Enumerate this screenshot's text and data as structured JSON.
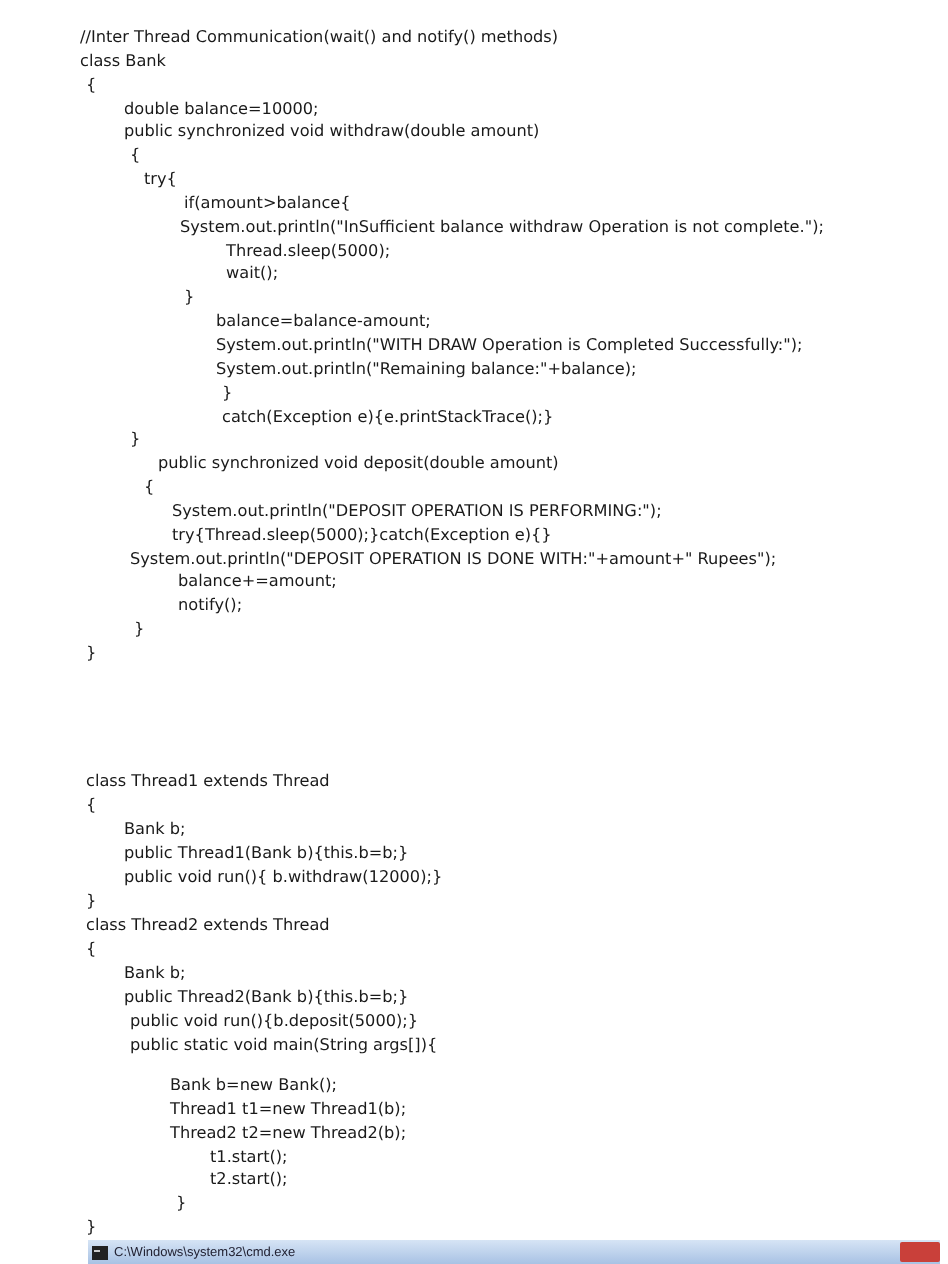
{
  "document": {
    "blocks": [
      {
        "lines": [
          "//Inter Thread Communication(wait() and notify() methods)",
          "class Bank",
          "{",
          "double balance=10000;",
          "public synchronized void withdraw(double amount)",
          "{",
          "try{",
          "if(amount>balance{",
          "System.out.println(\"InSufficient balance withdraw Operation is not complete.\");",
          "Thread.sleep(5000);",
          "wait();",
          "}",
          "balance=balance-amount;",
          "System.out.println(\"WITH DRAW Operation is Completed Successfully:\");",
          "System.out.println(\"Remaining balance:\"+balance);",
          "}",
          "catch(Exception e){e.printStackTrace();}",
          "}",
          "public synchronized void deposit(double amount)",
          "{",
          "System.out.println(\"DEPOSIT OPERATION IS PERFORMING:\");",
          "try{Thread.sleep(5000);}catch(Exception e){}",
          "System.out.println(\"DEPOSIT OPERATION IS DONE WITH:\"+amount+\" Rupees\");",
          "balance+=amount;",
          "notify();",
          "}",
          "}"
        ]
      },
      {
        "lines": [
          "class Thread1 extends Thread",
          "{",
          "Bank b;",
          "public Thread1(Bank b){this.b=b;}",
          "public void run(){ b.withdraw(12000);}",
          "}",
          "class Thread2 extends Thread",
          "{",
          "Bank b;",
          "public Thread2(Bank b){this.b=b;}",
          "public void run(){b.deposit(5000);}",
          "public static void main(String args[]){"
        ]
      },
      {
        "lines": [
          "Bank b=new Bank();",
          "Thread1 t1=new Thread1(b);",
          "Thread2 t2=new Thread2(b);",
          "t1.start();",
          "t2.start();",
          "}",
          "}"
        ]
      }
    ]
  },
  "console_window": {
    "title": "C:\\Windows\\system32\\cmd.exe"
  }
}
